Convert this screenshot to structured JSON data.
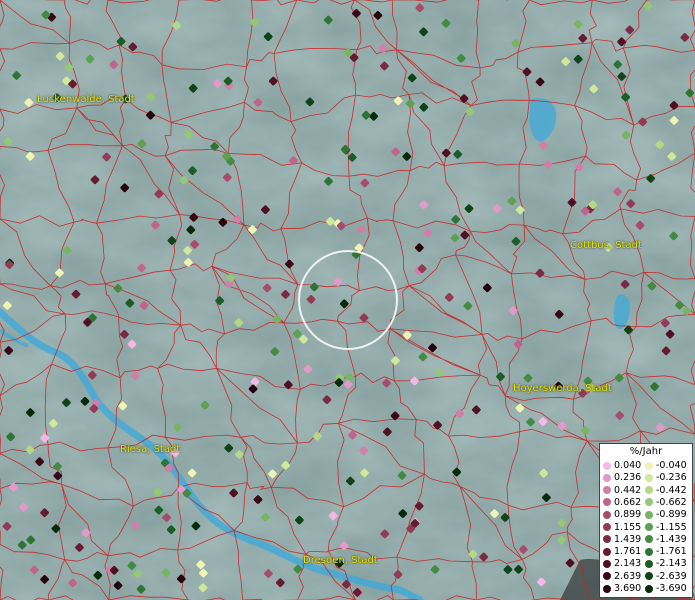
{
  "cities": [
    {
      "name": "Luckenwalde, Stadt"
    },
    {
      "name": "Cottbus, Stadt"
    },
    {
      "name": "Hoyerswerda, Stadt"
    },
    {
      "name": "Riesa, Stadt"
    },
    {
      "name": "Dresden, Stadt"
    }
  ],
  "legend": {
    "title": "%/Jahr",
    "positive": [
      "0.040",
      "0.236",
      "0.442",
      "0.662",
      "0.899",
      "1.155",
      "1.439",
      "1.761",
      "2.143",
      "2.639",
      "3.690"
    ],
    "negative": [
      "-0.040",
      "-0.236",
      "-0.442",
      "-0.662",
      "-0.899",
      "-1.155",
      "-1.439",
      "-1.761",
      "-2.143",
      "-2.639",
      "-3.690"
    ],
    "positive_colors": [
      "#f5b8e6",
      "#e39acb",
      "#d37ea8",
      "#c0648b",
      "#a84c6c",
      "#923a56",
      "#7a2a42",
      "#651c32",
      "#4f1023",
      "#3a0716",
      "#25020b"
    ],
    "negative_colors": [
      "#eef5b4",
      "#cfe899",
      "#b3d986",
      "#95c874",
      "#77b562",
      "#5ca051",
      "#438a42",
      "#2e7434",
      "#1c5c25",
      "#0e4417",
      "#052b0b"
    ]
  },
  "colors": {
    "boundary": "#cc2020",
    "water": "#3fa9d9",
    "terrain": "#7f9a99",
    "highlight_circle": "#ffffff",
    "city_label": "#e8e000"
  }
}
